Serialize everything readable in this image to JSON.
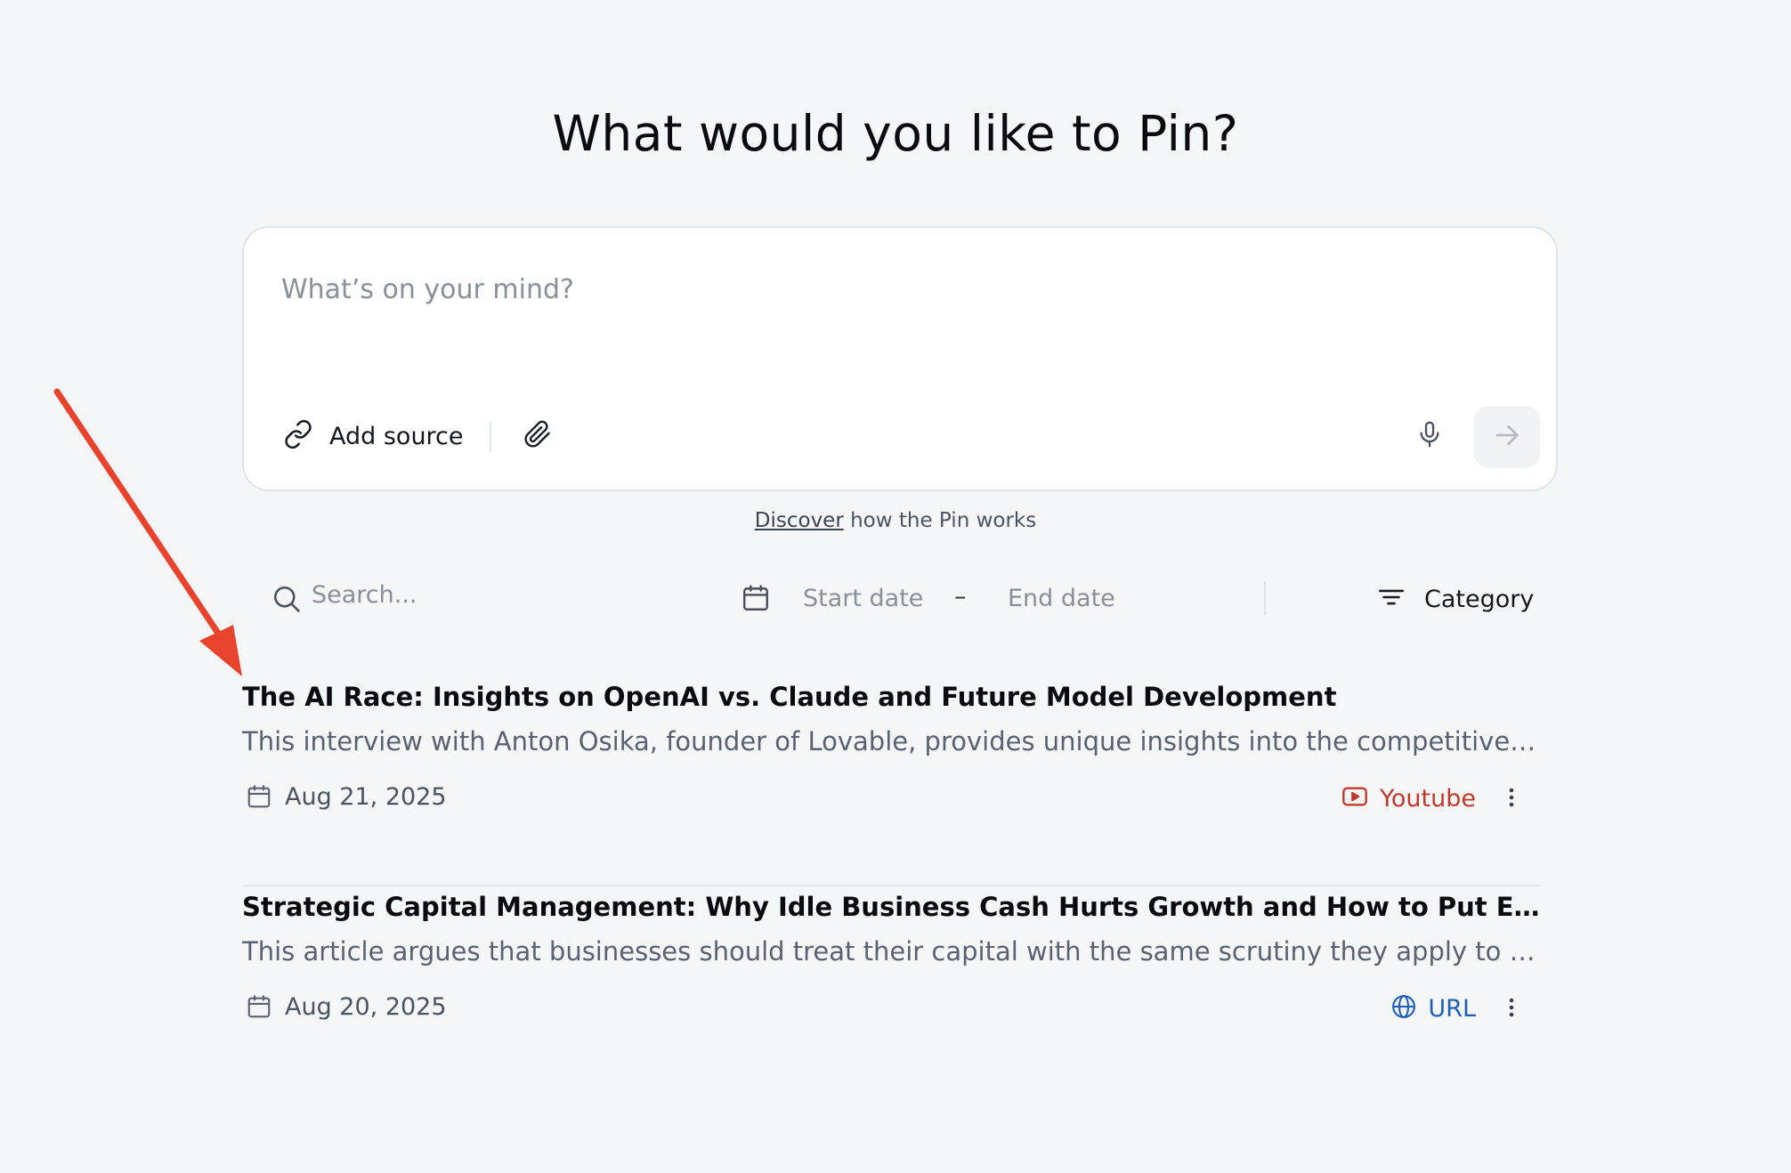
{
  "header": {
    "title": "What would you like to Pin?"
  },
  "composer": {
    "placeholder": "What’s on your mind?",
    "add_source_label": "Add source",
    "icons": {
      "link": "link-icon",
      "attach": "paperclip-icon",
      "mic": "microphone-icon",
      "send": "arrow-right-icon"
    }
  },
  "discover": {
    "link_text": "Discover",
    "rest_text": " how the Pin works"
  },
  "filters": {
    "search_placeholder": "Search...",
    "start_date_placeholder": "Start date",
    "date_separator": "–",
    "end_date_placeholder": "End date",
    "category_label": "Category",
    "icons": {
      "search": "search-icon",
      "calendar": "calendar-icon",
      "category": "filter-lines-icon"
    }
  },
  "items": [
    {
      "title": "The AI Race: Insights on OpenAI vs. Claude and Future Model Development",
      "description": "This interview with Anton Osika, founder of Lovable, provides unique insights into the competitive landscape of AI development and what it means for the future of model building.",
      "date": "Aug 21, 2025",
      "source": "Youtube",
      "source_icon": "youtube-icon",
      "source_color": "#c0392b"
    },
    {
      "title": "Strategic Capital Management: Why Idle Business Cash Hurts Growth and How to Put Every Dollar to Work",
      "description": "This article argues that businesses should treat their capital with the same scrutiny they apply to every other investment decision they make.",
      "date": "Aug 20, 2025",
      "source": "URL",
      "source_icon": "globe-icon",
      "source_color": "#1f5fb5"
    }
  ],
  "colors": {
    "background": "#f5f6f8",
    "card": "#ffffff",
    "annotation_arrow": "#e8432d"
  }
}
